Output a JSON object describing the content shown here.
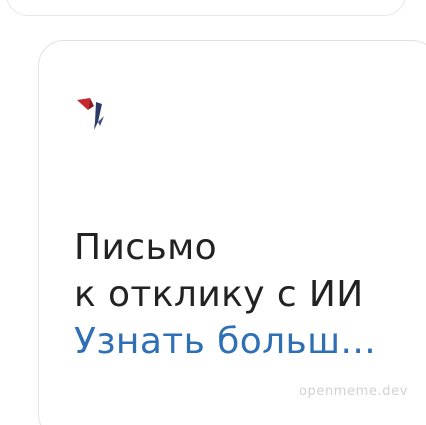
{
  "card": {
    "logo_icon": "origami-bird-logo-icon",
    "title_line1": "Письмо",
    "title_line2": "к отклику с ИИ",
    "link_text": "Узнать больш..."
  },
  "watermark": "openmeme.dev",
  "colors": {
    "text": "#222222",
    "link": "#2f6fb4",
    "logo_red": "#c9252b",
    "logo_navy": "#2b3a67",
    "border": "#e2e2e2",
    "background": "#ffffff"
  }
}
